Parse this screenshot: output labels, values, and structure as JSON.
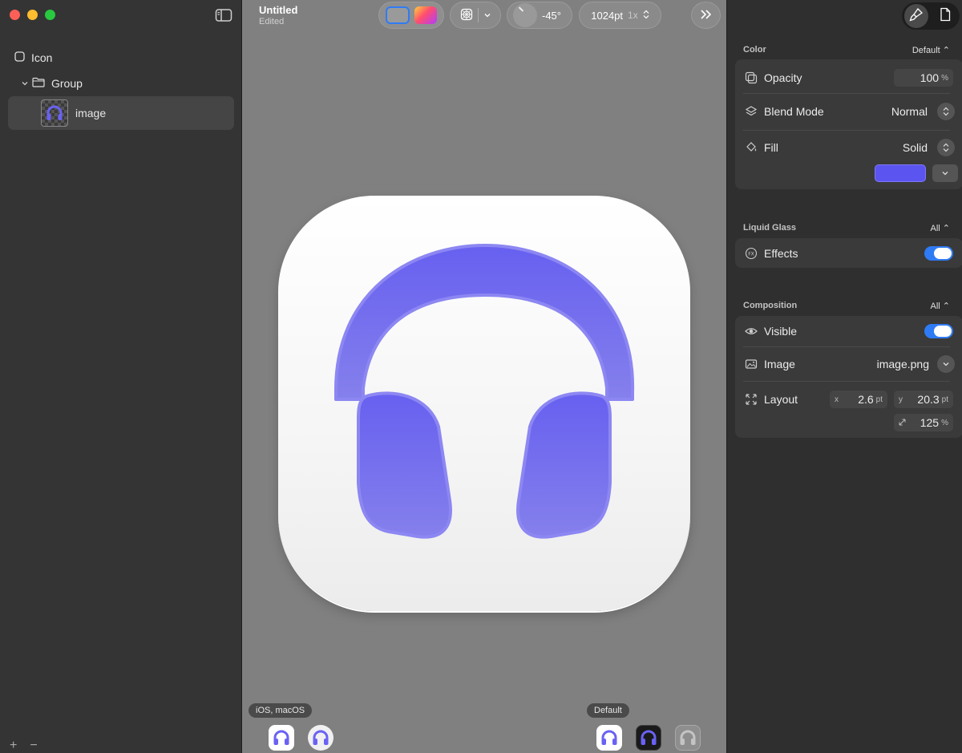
{
  "window": {
    "title": "Untitled",
    "subtitle": "Edited"
  },
  "sidebar": {
    "layers": [
      {
        "label": "Icon"
      },
      {
        "label": "Group"
      },
      {
        "label": "image"
      }
    ],
    "add_label": "+",
    "remove_label": "−"
  },
  "toolbar": {
    "angle_value": "-45°",
    "size_value": "1024pt",
    "scale_value": "1x"
  },
  "canvas": {
    "platform_label": "iOS, macOS",
    "appearance_label": "Default",
    "accent_color": "#5b54f0"
  },
  "inspector": {
    "color": {
      "header": "Color",
      "mode": "Default",
      "opacity_label": "Opacity",
      "opacity_value": "100",
      "opacity_unit": "%",
      "blend_label": "Blend Mode",
      "blend_value": "Normal",
      "fill_label": "Fill",
      "fill_value": "Solid",
      "fill_color": "#5b54f0"
    },
    "liquid_glass": {
      "header": "Liquid Glass",
      "mode": "All",
      "effects_label": "Effects",
      "effects_on": true
    },
    "composition": {
      "header": "Composition",
      "mode": "All",
      "visible_label": "Visible",
      "visible_on": true,
      "image_label": "Image",
      "image_value": "image.png",
      "layout_label": "Layout",
      "x_label": "x",
      "x_value": "2.6",
      "y_label": "y",
      "y_value": "20.3",
      "unit_pt": "pt",
      "scale_value": "125",
      "scale_unit": "%"
    }
  }
}
